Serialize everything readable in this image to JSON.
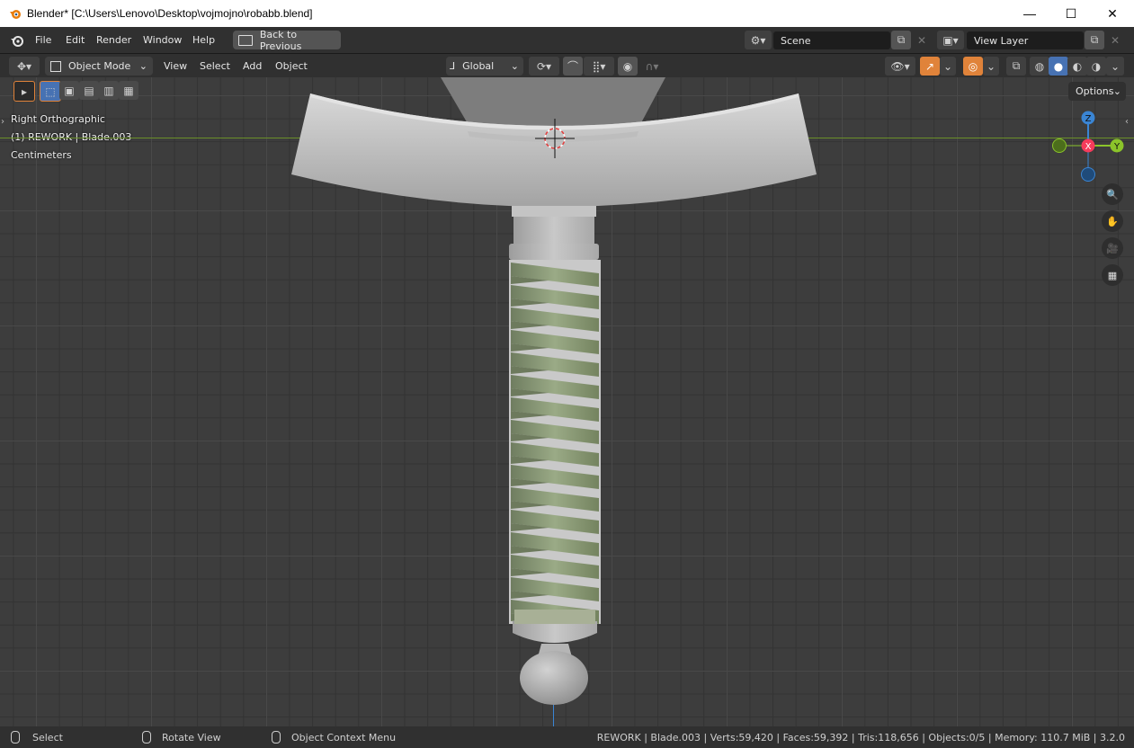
{
  "window": {
    "title": "Blender* [C:\\Users\\Lenovo\\Desktop\\vojmojno\\robabb.blend]",
    "minimize": "—",
    "maximize": "☐",
    "close": "✕"
  },
  "topbar": {
    "menus": [
      "File",
      "Edit",
      "Render",
      "Window",
      "Help"
    ],
    "back_label": "Back to Previous",
    "scene_name": "Scene",
    "view_layer": "View Layer"
  },
  "header": {
    "mode": "Object Mode",
    "menus": [
      "View",
      "Select",
      "Add",
      "Object"
    ],
    "orientation": "Global",
    "options_label": "Options"
  },
  "viewport": {
    "view_name": "Right Orthographic",
    "object_info": "(1) REWORK | Blade.003",
    "units": "Centimeters",
    "gizmo": {
      "x": "X",
      "y": "Y",
      "z": "Z"
    }
  },
  "statusbar": {
    "left": [
      {
        "icon": "mouse-left-icon",
        "label": "Select"
      },
      {
        "icon": "mouse-middle-icon",
        "label": "Rotate View"
      },
      {
        "icon": "mouse-right-icon",
        "label": "Object Context Menu"
      }
    ],
    "stats": "REWORK | Blade.003 | Verts:59,420 | Faces:59,392 | Tris:118,656 | Objects:0/5 | Memory: 110.7 MiB | 3.2.0"
  },
  "colors": {
    "accent": "#4772b3",
    "orange": "#e0833a",
    "axis_x": "#f53b5b",
    "axis_y": "#8bc42a",
    "axis_z": "#3a85d4",
    "wrap": "#8a9a78"
  }
}
